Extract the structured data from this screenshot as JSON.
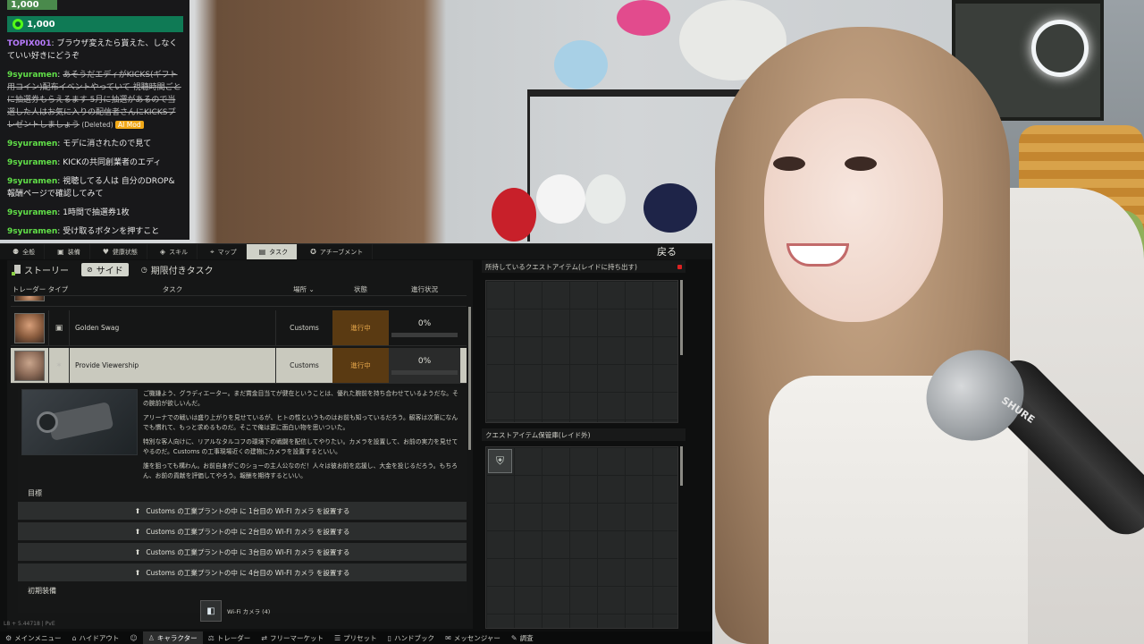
{
  "chat": {
    "gift_top_amount": "1,000",
    "gift_amount": "1,000",
    "messages": [
      {
        "user": "TOPIX001",
        "user_color": "#b97cff",
        "text": "ブラウザ変えたら貰えた、しなくていい好きにどうぞ",
        "deleted": false
      },
      {
        "user": "9syuramen",
        "user_color": "#61e048",
        "text": "あそうだエディがKICKS(ギフト用コイン)配布イベントやっていて 視聴時間ごとに抽選券もらえるます 5月に抽選があるので当選した人はお気に入りの配信者さんにKICKSプレゼントしましょう",
        "deleted": true,
        "deleted_label": "(Deleted)",
        "mod_label": "AI Mod"
      },
      {
        "user": "9syuramen",
        "user_color": "#61e048",
        "text": "モデに消されたので見て",
        "deleted": false
      },
      {
        "user": "9syuramen",
        "user_color": "#61e048",
        "text": "KICKの共同創業者のエディ",
        "deleted": false
      },
      {
        "user": "9syuramen",
        "user_color": "#61e048",
        "text": "視聴してる人は 自分のDROP&報酬ページで確認してみて",
        "deleted": false
      },
      {
        "user": "9syuramen",
        "user_color": "#61e048",
        "text": "1時間で抽選券1枚",
        "deleted": false
      },
      {
        "user": "9syuramen",
        "user_color": "#61e048",
        "text": "受け取るボタンを押すこと",
        "deleted": false
      }
    ]
  },
  "game": {
    "top_tabs": [
      {
        "label": "全般",
        "icon": "person-icon",
        "active": false
      },
      {
        "label": "装備",
        "icon": "gear-bag-icon",
        "active": false
      },
      {
        "label": "健康状態",
        "icon": "health-icon",
        "active": false
      },
      {
        "label": "スキル",
        "icon": "skill-icon",
        "active": false
      },
      {
        "label": "マップ",
        "icon": "map-icon",
        "active": false
      },
      {
        "label": "タスク",
        "icon": "task-icon",
        "active": true
      },
      {
        "label": "アチーブメント",
        "icon": "achievement-icon",
        "active": false
      }
    ],
    "back_label": "戻る",
    "sub_tabs": [
      {
        "label": "ストーリー",
        "active": false
      },
      {
        "label": "サイド",
        "active": true
      },
      {
        "label": "期限付きタスク",
        "active": false
      }
    ],
    "table_headers": {
      "trader_type": "トレーダー タイプ",
      "task": "タスク",
      "location": "場所",
      "status": "状態",
      "progress": "進行状況"
    },
    "rows": [
      {
        "task": "Golden Swag",
        "location": "Customs",
        "status": "進行中",
        "progress": "0%",
        "type_icon": "box-icon",
        "selected": false
      },
      {
        "task": "Provide Viewership",
        "location": "Customs",
        "status": "進行中",
        "progress": "0%",
        "type_icon": "star-icon",
        "selected": true
      }
    ],
    "detail": {
      "paragraphs": [
        "ご機嫌よう、グラディエーター。まだ賞金目当てが健在ということは、優れた腕前を持ち合わせているようだな。その腕前が欲しいんだ。",
        "アリーナでの戦いは盛り上がりを見せているが、ヒトの性というものはお前も知っているだろう。観客は次第になんでも慣れて、もっと求めるものだ。そこで俺は更に面白い物を思いついた。",
        "特別な客人向けに、リアルなタルコフの環境下の戦闘を配信してやりたい。カメラを設置して、お前の実力を見せてやるのだ。Customs の工事現場近くの建物にカメラを設置するといい。",
        "誰を狙っても構わん。お前自身がこのショーの主人公なのだ！人々は彼お前を応援し、大金を投じるだろう。もちろん、お前の貢献を評価してやろう。報酬を期待するといい。"
      ],
      "objectives_heading": "目標",
      "objectives": [
        "Customs の工業プラントの中 に 1台目の WI-FI カメラ を設置する",
        "Customs の工業プラントの中 に 2台目の WI-FI カメラ を設置する",
        "Customs の工業プラントの中 に 3台目の WI-FI カメラ を設置する",
        "Customs の工業プラントの中 に 4台目の WI-FI カメラ を設置する"
      ],
      "equipment_heading": "初期装備",
      "equipment_item": "Wi-Fi カメラ (4)"
    },
    "right_panel": {
      "quest_items_title": "所持しているクエストアイテム(レイドに持ち出す)",
      "stash_title": "クエストアイテム保管庫(レイド外)"
    },
    "version": "L8 + 5.44718 | PvE",
    "bottom_bar": [
      {
        "label": "メインメニュー",
        "icon": "menu-icon",
        "active": false
      },
      {
        "label": "ハイドアウト",
        "icon": "hideout-icon",
        "active": false
      },
      {
        "label": "",
        "icon": "mask-icon",
        "active": false
      },
      {
        "label": "キャラクター",
        "icon": "character-icon",
        "active": true
      },
      {
        "label": "トレーダー",
        "icon": "trader-icon",
        "active": false
      },
      {
        "label": "フリーマーケット",
        "icon": "market-icon",
        "active": false
      },
      {
        "label": "プリセット",
        "icon": "preset-icon",
        "active": false
      },
      {
        "label": "ハンドブック",
        "icon": "handbook-icon",
        "active": false
      },
      {
        "label": "メッセンジャー",
        "icon": "messenger-icon",
        "active": false
      },
      {
        "label": "調査",
        "icon": "survey-icon",
        "active": false
      }
    ]
  },
  "webcam": {
    "mic_brand": "SHURE"
  }
}
